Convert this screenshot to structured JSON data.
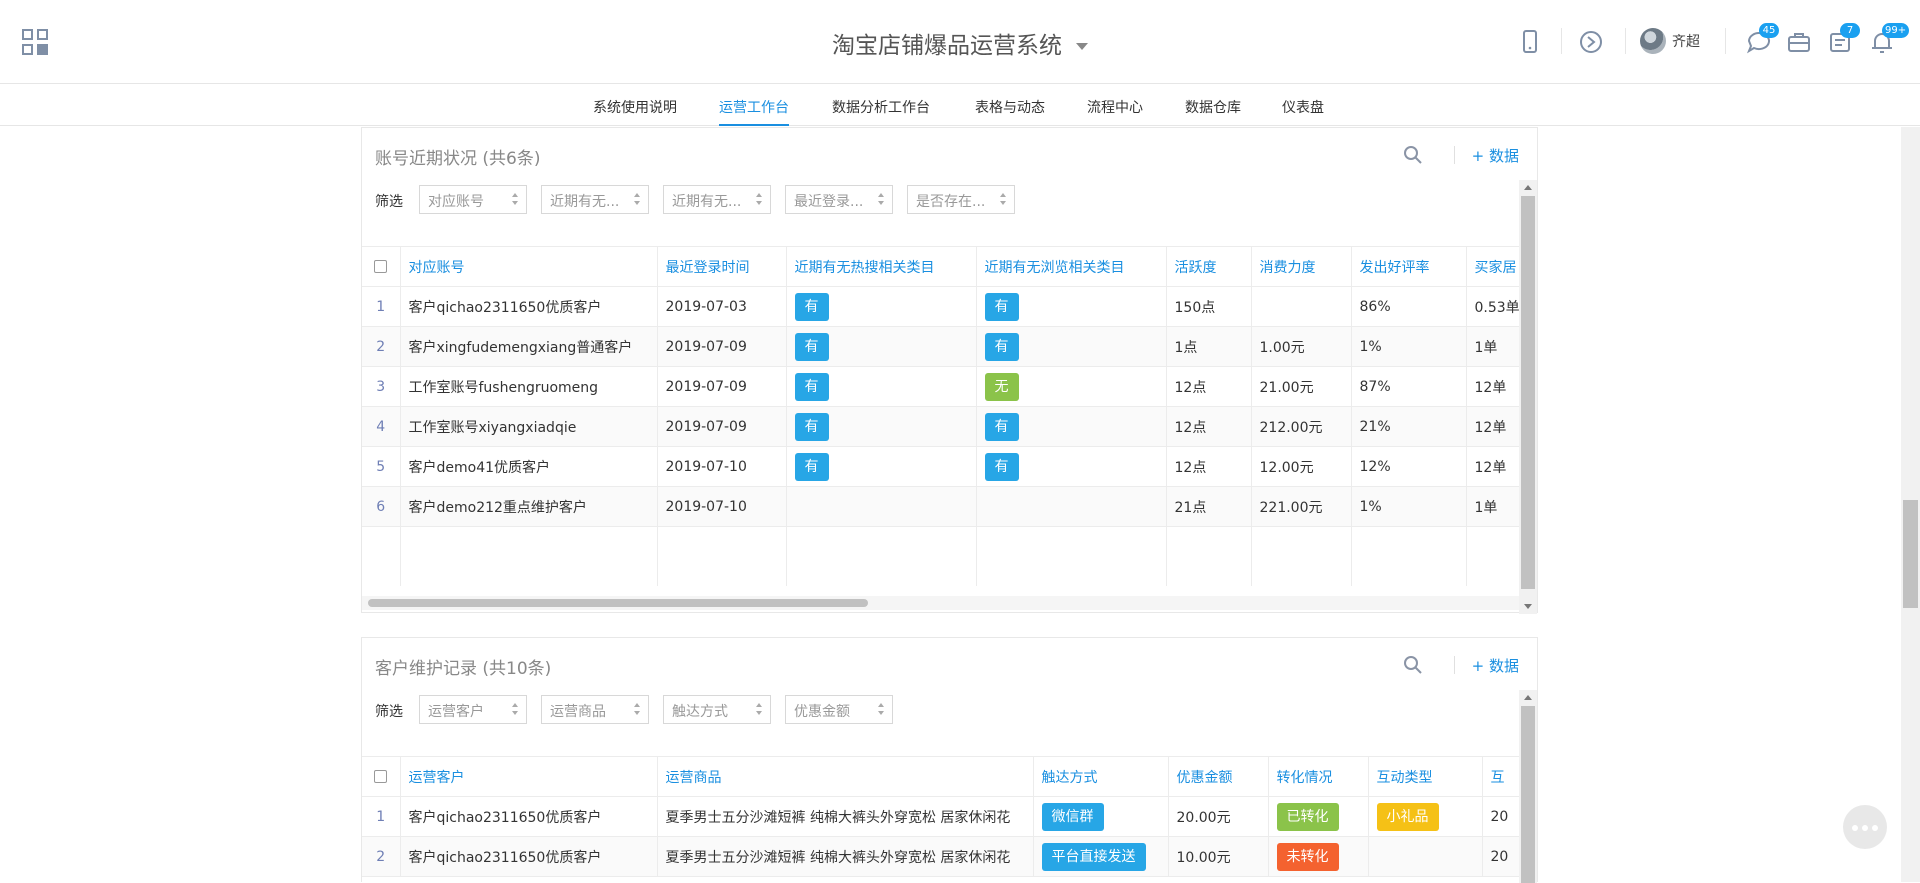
{
  "header": {
    "title": "淘宝店铺爆品运营系统",
    "user_name": "齐超",
    "badges": {
      "messages": "45",
      "tasks": "7",
      "notifications": "99+"
    }
  },
  "nav": {
    "items": [
      "系统使用说明",
      "运营工作台",
      "数据分析工作台",
      "表格与动态",
      "流程中心",
      "数据仓库",
      "仪表盘"
    ],
    "active": "运营工作台"
  },
  "account_card": {
    "title": "账号近期状况 (共6条)",
    "add_label": "+ 数据",
    "filter_label": "筛选",
    "filters": [
      "对应账号",
      "近期有无...",
      "近期有无...",
      "最近登录...",
      "是否存在..."
    ],
    "columns": [
      "对应账号",
      "最近登录时间",
      "近期有无热搜相关类目",
      "近期有无浏览相关类目",
      "活跃度",
      "消费力度",
      "发出好评率",
      "买家居"
    ],
    "rows": [
      {
        "idx": "1",
        "account": "客户qichao2311650优质客户",
        "last_login": "2019-07-03",
        "hot_search": "有",
        "browse": "有",
        "activity": "150点",
        "spend": "",
        "good_rate": "86%",
        "buyer": "0.53单"
      },
      {
        "idx": "2",
        "account": "客户xingfudemengxiang普通客户",
        "last_login": "2019-07-09",
        "hot_search": "有",
        "browse": "有",
        "activity": "1点",
        "spend": "1.00元",
        "good_rate": "1%",
        "buyer": "1单"
      },
      {
        "idx": "3",
        "account": "工作室账号fushengruomeng",
        "last_login": "2019-07-09",
        "hot_search": "有",
        "browse": "无",
        "activity": "12点",
        "spend": "21.00元",
        "good_rate": "87%",
        "buyer": "12单"
      },
      {
        "idx": "4",
        "account": "工作室账号xiyangxiadqie",
        "last_login": "2019-07-09",
        "hot_search": "有",
        "browse": "有",
        "activity": "12点",
        "spend": "212.00元",
        "good_rate": "21%",
        "buyer": "12单"
      },
      {
        "idx": "5",
        "account": "客户demo41优质客户",
        "last_login": "2019-07-10",
        "hot_search": "有",
        "browse": "有",
        "activity": "12点",
        "spend": "12.00元",
        "good_rate": "12%",
        "buyer": "12单"
      },
      {
        "idx": "6",
        "account": "客户demo212重点维护客户",
        "last_login": "2019-07-10",
        "hot_search": "",
        "browse": "",
        "activity": "21点",
        "spend": "221.00元",
        "good_rate": "1%",
        "buyer": "1单"
      }
    ]
  },
  "maintenance_card": {
    "title": "客户维护记录 (共10条)",
    "add_label": "+ 数据",
    "filter_label": "筛选",
    "filters": [
      "运营客户",
      "运营商品",
      "触达方式",
      "优惠金额"
    ],
    "columns": [
      "运营客户",
      "运营商品",
      "触达方式",
      "优惠金额",
      "转化情况",
      "互动类型",
      "互"
    ],
    "rows": [
      {
        "idx": "1",
        "customer": "客户qichao2311650优质客户",
        "product": "夏季男士五分沙滩短裤 纯棉大裤头外穿宽松 居家休闲花",
        "channel": "微信群",
        "discount": "20.00元",
        "conversion": "已转化",
        "interaction": "小礼品",
        "extra": "20"
      },
      {
        "idx": "2",
        "customer": "客户qichao2311650优质客户",
        "product": "夏季男士五分沙滩短裤 纯棉大裤头外穿宽松 居家休闲花",
        "channel": "平台直接发送",
        "discount": "10.00元",
        "conversion": "未转化",
        "interaction": "",
        "extra": "20"
      }
    ]
  }
}
